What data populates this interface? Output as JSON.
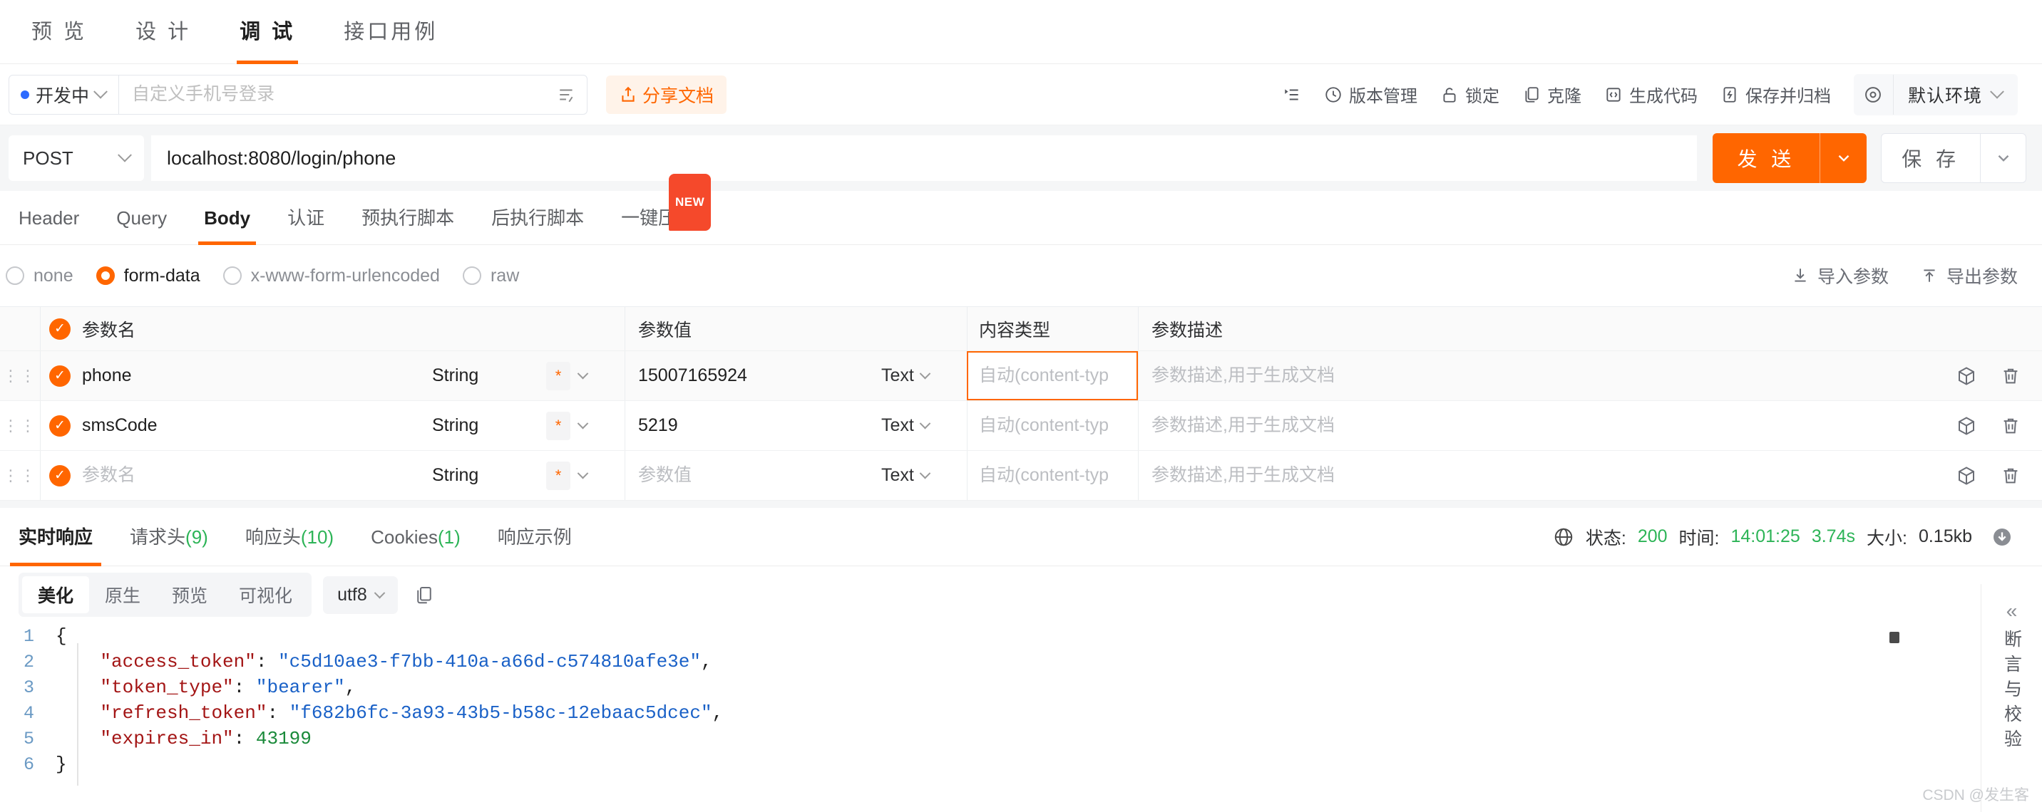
{
  "top_tabs": [
    {
      "label": "预 览",
      "active": false
    },
    {
      "label": "设 计",
      "active": false
    },
    {
      "label": "调 试",
      "active": true
    },
    {
      "label": "接口用例",
      "active": false
    }
  ],
  "toolbar": {
    "status_label": "开发中",
    "name_placeholder": "自定义手机号登录",
    "share_label": "分享文档",
    "items": [
      {
        "label": "版本管理",
        "icon": "clock-icon"
      },
      {
        "label": "锁定",
        "icon": "lock-icon"
      },
      {
        "label": "克隆",
        "icon": "clone-icon"
      },
      {
        "label": "生成代码",
        "icon": "code-icon"
      },
      {
        "label": "保存并归档",
        "icon": "archive-icon"
      }
    ],
    "env_label": "默认环境"
  },
  "request": {
    "method": "POST",
    "url": "localhost:8080/login/phone",
    "send_label": "发 送",
    "save_label": "保 存"
  },
  "sub_tabs": [
    {
      "label": "Header",
      "active": false,
      "badge": ""
    },
    {
      "label": "Query",
      "active": false,
      "badge": ""
    },
    {
      "label": "Body",
      "active": true,
      "badge": ""
    },
    {
      "label": "认证",
      "active": false,
      "badge": ""
    },
    {
      "label": "预执行脚本",
      "active": false,
      "badge": ""
    },
    {
      "label": "后执行脚本",
      "active": false,
      "badge": ""
    },
    {
      "label": "一键压测",
      "active": false,
      "badge": "NEW"
    }
  ],
  "body_types": [
    {
      "label": "none",
      "selected": false
    },
    {
      "label": "form-data",
      "selected": true
    },
    {
      "label": "x-www-form-urlencoded",
      "selected": false
    },
    {
      "label": "raw",
      "selected": false
    }
  ],
  "params_actions": {
    "import_label": "导入参数",
    "export_label": "导出参数"
  },
  "params_table": {
    "headers": {
      "name": "参数名",
      "value": "参数值",
      "content_type": "内容类型",
      "description": "参数描述"
    },
    "placeholders": {
      "name": "参数名",
      "value": "参数值",
      "content_type": "自动(content-typ",
      "description": "参数描述,用于生成文档"
    },
    "rows": [
      {
        "checked": true,
        "name": "phone",
        "type": "String",
        "required": "*",
        "value": "15007165924",
        "value_type": "Text",
        "content_type": "",
        "description": "",
        "focused_content_type": true
      },
      {
        "checked": true,
        "name": "smsCode",
        "type": "String",
        "required": "*",
        "value": "5219",
        "value_type": "Text",
        "content_type": "",
        "description": "",
        "focused_content_type": false
      },
      {
        "checked": true,
        "name": "",
        "type": "String",
        "required": "*",
        "value": "",
        "value_type": "Text",
        "content_type": "",
        "description": "",
        "focused_content_type": false
      }
    ]
  },
  "response": {
    "tabs": [
      {
        "label": "实时响应",
        "count": "",
        "active": true
      },
      {
        "label": "请求头",
        "count": "(9)",
        "active": false
      },
      {
        "label": "响应头",
        "count": "(10)",
        "active": false
      },
      {
        "label": "Cookies",
        "count": "(1)",
        "active": false
      },
      {
        "label": "响应示例",
        "count": "",
        "active": false
      }
    ],
    "meta": {
      "status_label": "状态:",
      "status_value": "200",
      "time_label": "时间:",
      "time_value": "14:01:25",
      "duration": "3.74s",
      "size_label": "大小:",
      "size_value": "0.15kb"
    },
    "view_modes": [
      {
        "label": "美化",
        "active": true
      },
      {
        "label": "原生",
        "active": false
      },
      {
        "label": "预览",
        "active": false
      },
      {
        "label": "可视化",
        "active": false
      }
    ],
    "encoding": "utf8",
    "code_lines": [
      {
        "no": "1",
        "segments": [
          {
            "t": "{",
            "c": "p"
          }
        ]
      },
      {
        "no": "2",
        "segments": [
          {
            "t": "    ",
            "c": "p"
          },
          {
            "t": "\"access_token\"",
            "c": "k"
          },
          {
            "t": ": ",
            "c": "p"
          },
          {
            "t": "\"c5d10ae3-f7bb-410a-a66d-c574810afe3e\"",
            "c": "s"
          },
          {
            "t": ",",
            "c": "p"
          }
        ]
      },
      {
        "no": "3",
        "segments": [
          {
            "t": "    ",
            "c": "p"
          },
          {
            "t": "\"token_type\"",
            "c": "k"
          },
          {
            "t": ": ",
            "c": "p"
          },
          {
            "t": "\"bearer\"",
            "c": "s"
          },
          {
            "t": ",",
            "c": "p"
          }
        ]
      },
      {
        "no": "4",
        "segments": [
          {
            "t": "    ",
            "c": "p"
          },
          {
            "t": "\"refresh_token\"",
            "c": "k"
          },
          {
            "t": ": ",
            "c": "p"
          },
          {
            "t": "\"f682b6fc-3a93-43b5-b58c-12ebaac5dcec\"",
            "c": "s"
          },
          {
            "t": ",",
            "c": "p"
          }
        ]
      },
      {
        "no": "5",
        "segments": [
          {
            "t": "    ",
            "c": "p"
          },
          {
            "t": "\"expires_in\"",
            "c": "k"
          },
          {
            "t": ": ",
            "c": "p"
          },
          {
            "t": "43199",
            "c": "n"
          }
        ]
      },
      {
        "no": "6",
        "segments": [
          {
            "t": "}",
            "c": "p"
          }
        ]
      }
    ]
  },
  "right_rail": {
    "collapse_icon": "«",
    "label": "断言与校验"
  },
  "watermark": "CSDN @发生客",
  "colors": {
    "accent": "#ff6600",
    "success": "#2db457",
    "badge": "#f5492b"
  }
}
